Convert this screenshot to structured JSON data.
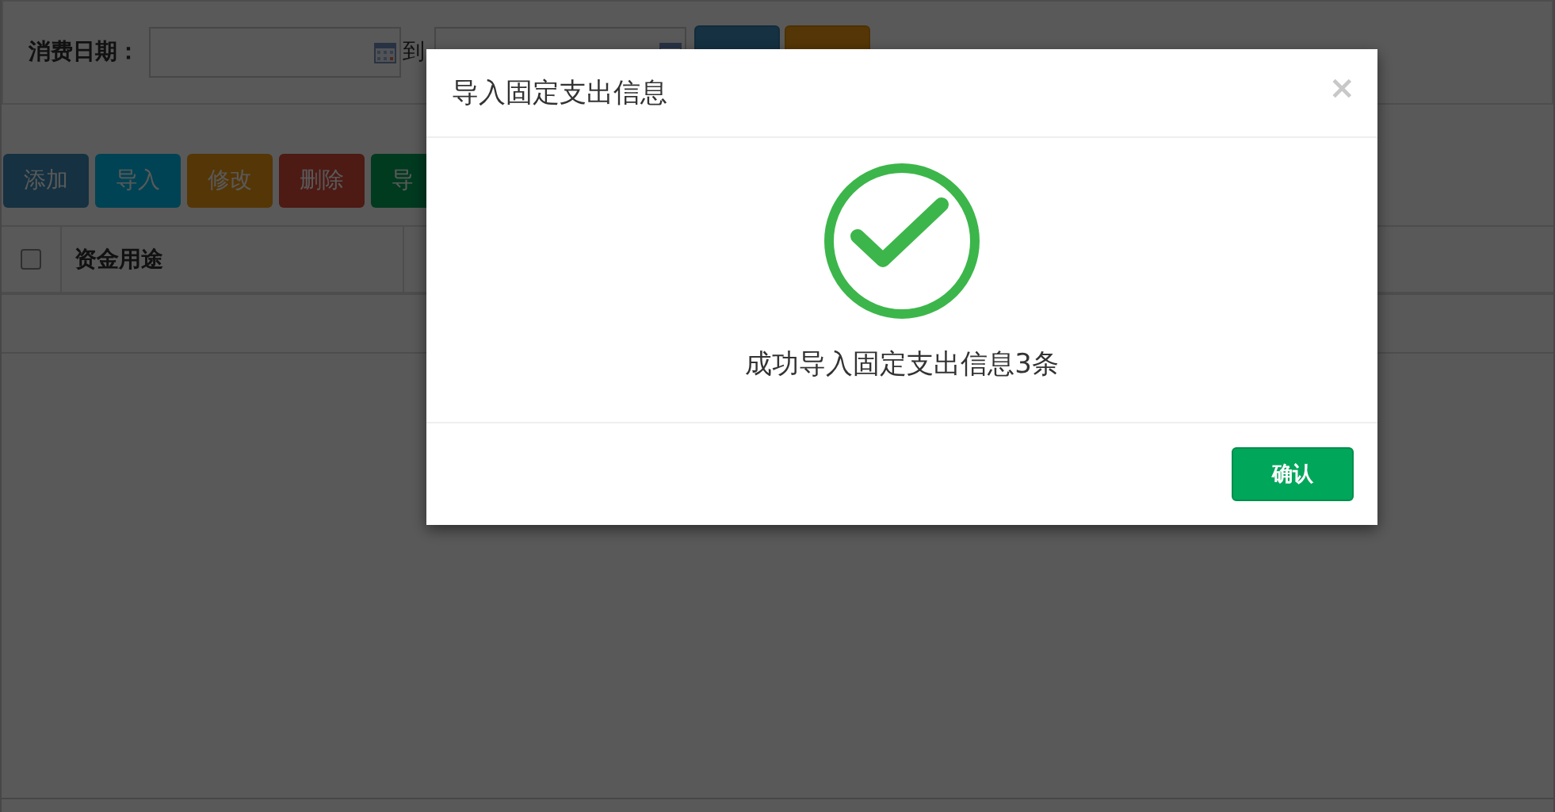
{
  "filter": {
    "label": "消费日期：",
    "separator": "到"
  },
  "search_buttons": [
    {
      "kind": "query"
    },
    {
      "kind": "clear"
    }
  ],
  "toolbar": [
    {
      "label": "添加",
      "kind": "add"
    },
    {
      "label": "导入",
      "kind": "import"
    },
    {
      "label": "修改",
      "kind": "edit"
    },
    {
      "label": "删除",
      "kind": "delete"
    },
    {
      "label": "导",
      "kind": "export"
    }
  ],
  "table": {
    "select_all": {
      "checked": false
    },
    "columns": [
      "资金用途"
    ]
  },
  "modal": {
    "title": "导入固定支出信息",
    "close": "×",
    "message": "成功导入固定支出信息3条",
    "confirm_button": "确认"
  }
}
